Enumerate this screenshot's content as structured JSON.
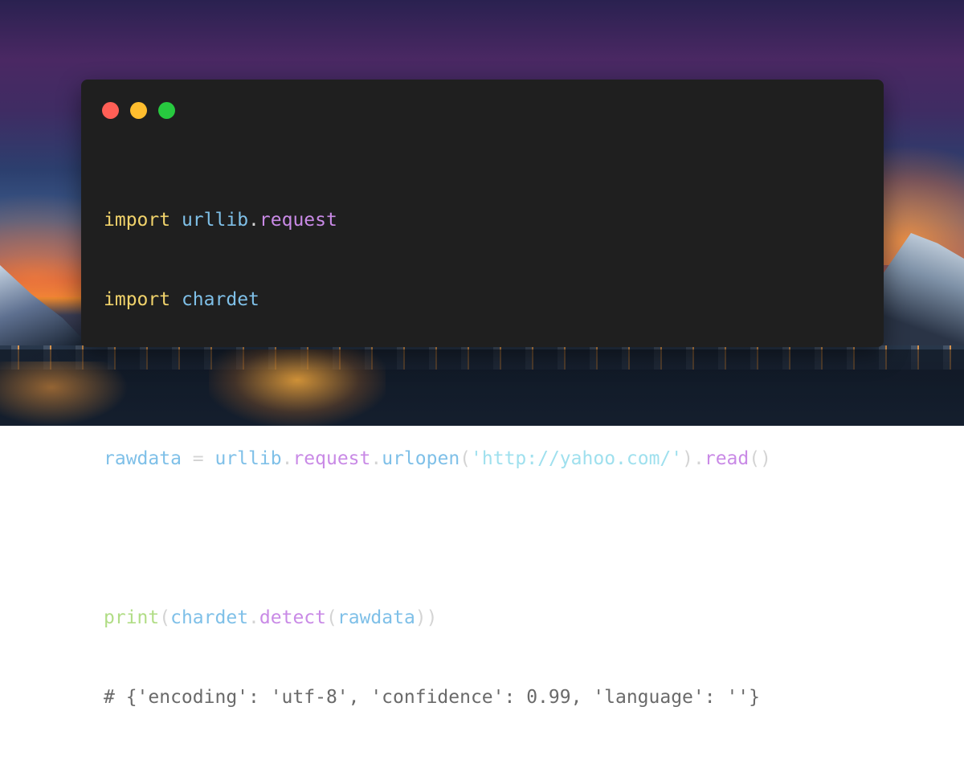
{
  "background": {
    "description_colors": [
      "#2a2150",
      "#4a2863",
      "#c8593a",
      "#e9862e",
      "#172434"
    ]
  },
  "window": {
    "bg_color": "#1f1f1f",
    "controls": {
      "close_color": "#ff5f56",
      "minimize_color": "#ffbd2e",
      "maximize_color": "#27c93f"
    },
    "code": {
      "line1": {
        "kw": "import",
        "mod": "urllib",
        "dot": ".",
        "sub": "request"
      },
      "line2": {
        "kw": "import",
        "mod": "chardet"
      },
      "line4": {
        "var": "rawdata",
        "eq": " = ",
        "mod": "urllib",
        "dot1": ".",
        "sub": "request",
        "dot2": ".",
        "fn": "urlopen",
        "open": "(",
        "str": "'http://yahoo.com/'",
        "close": ")",
        "dot3": ".",
        "fn2": "read",
        "parens": "()"
      },
      "line6": {
        "fn": "print",
        "open": "(",
        "mod": "chardet",
        "dot": ".",
        "call": "detect",
        "open2": "(",
        "arg": "rawdata",
        "close": "))"
      },
      "line7": {
        "comment": "# {'encoding': 'utf-8', 'confidence': 0.99, 'language': ''}"
      }
    }
  }
}
